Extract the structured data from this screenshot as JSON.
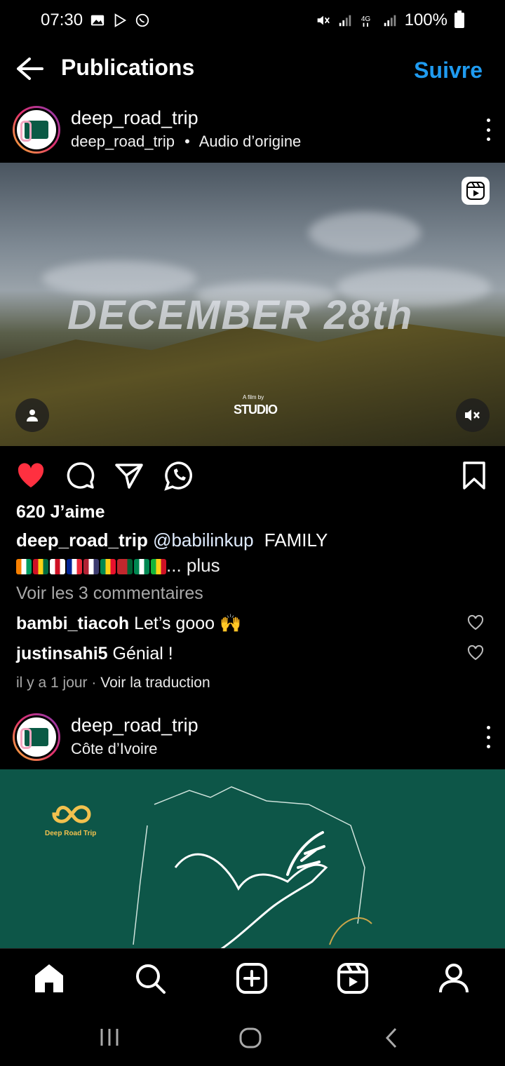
{
  "status_bar": {
    "time": "07:30",
    "left_icons": [
      "gallery-icon",
      "play-store-icon",
      "whatsapp-icon"
    ],
    "right_icons": [
      "mute-icon",
      "signal-icon",
      "4g-icon",
      "signal-icon"
    ],
    "battery": "100%"
  },
  "header": {
    "title": "Publications",
    "follow_label": "Suivre"
  },
  "post1": {
    "username": "deep_road_trip",
    "sub_user": "deep_road_trip",
    "sub_separator": "•",
    "audio": "Audio d’origine",
    "media_overlay_text": "DECEMBER 28th",
    "film_by": "A film by",
    "studio": "STUDIO",
    "likes": "620 J’aime",
    "caption_user": "deep_road_trip",
    "caption_mention": "@babilinkup",
    "caption_text": "FAMILY",
    "more": "... plus",
    "flags": [
      "#f77f00|#ffffff|#009e60",
      "#ce1126|#fcd116|#006b3f",
      "#ffffff|#ce1124|#ffffff",
      "#002395|#ffffff|#ed2939",
      "#b22234|#ffffff|#3c3b6e",
      "#008751|#fcd116|#e8112d",
      "#c1272d|#c1272d|#006233",
      "#008751|#ffffff|#008751",
      "#14b53a|#fcd116|#ce1126"
    ],
    "view_comments": "Voir les 3 commentaires",
    "comments": [
      {
        "user": "bambi_tiacoh",
        "text": "Let’s gooo 🙌"
      },
      {
        "user": "justinsahi5",
        "text": "Génial !"
      }
    ],
    "time": "il y a 1 jour",
    "time_sep": " · ",
    "translate": "Voir la traduction"
  },
  "post2": {
    "username": "deep_road_trip",
    "location": "Côte d’Ivoire",
    "logo_text": "Deep Road Trip"
  },
  "colors": {
    "accent": "#1f9bf0",
    "like": "#ff3040",
    "post2_bg": "#0d5648"
  },
  "bottom_nav": [
    "home-icon",
    "search-icon",
    "create-icon",
    "reels-icon",
    "profile-icon"
  ],
  "system_nav": [
    "recents-icon",
    "home-circle-icon",
    "back-chevron-icon"
  ]
}
